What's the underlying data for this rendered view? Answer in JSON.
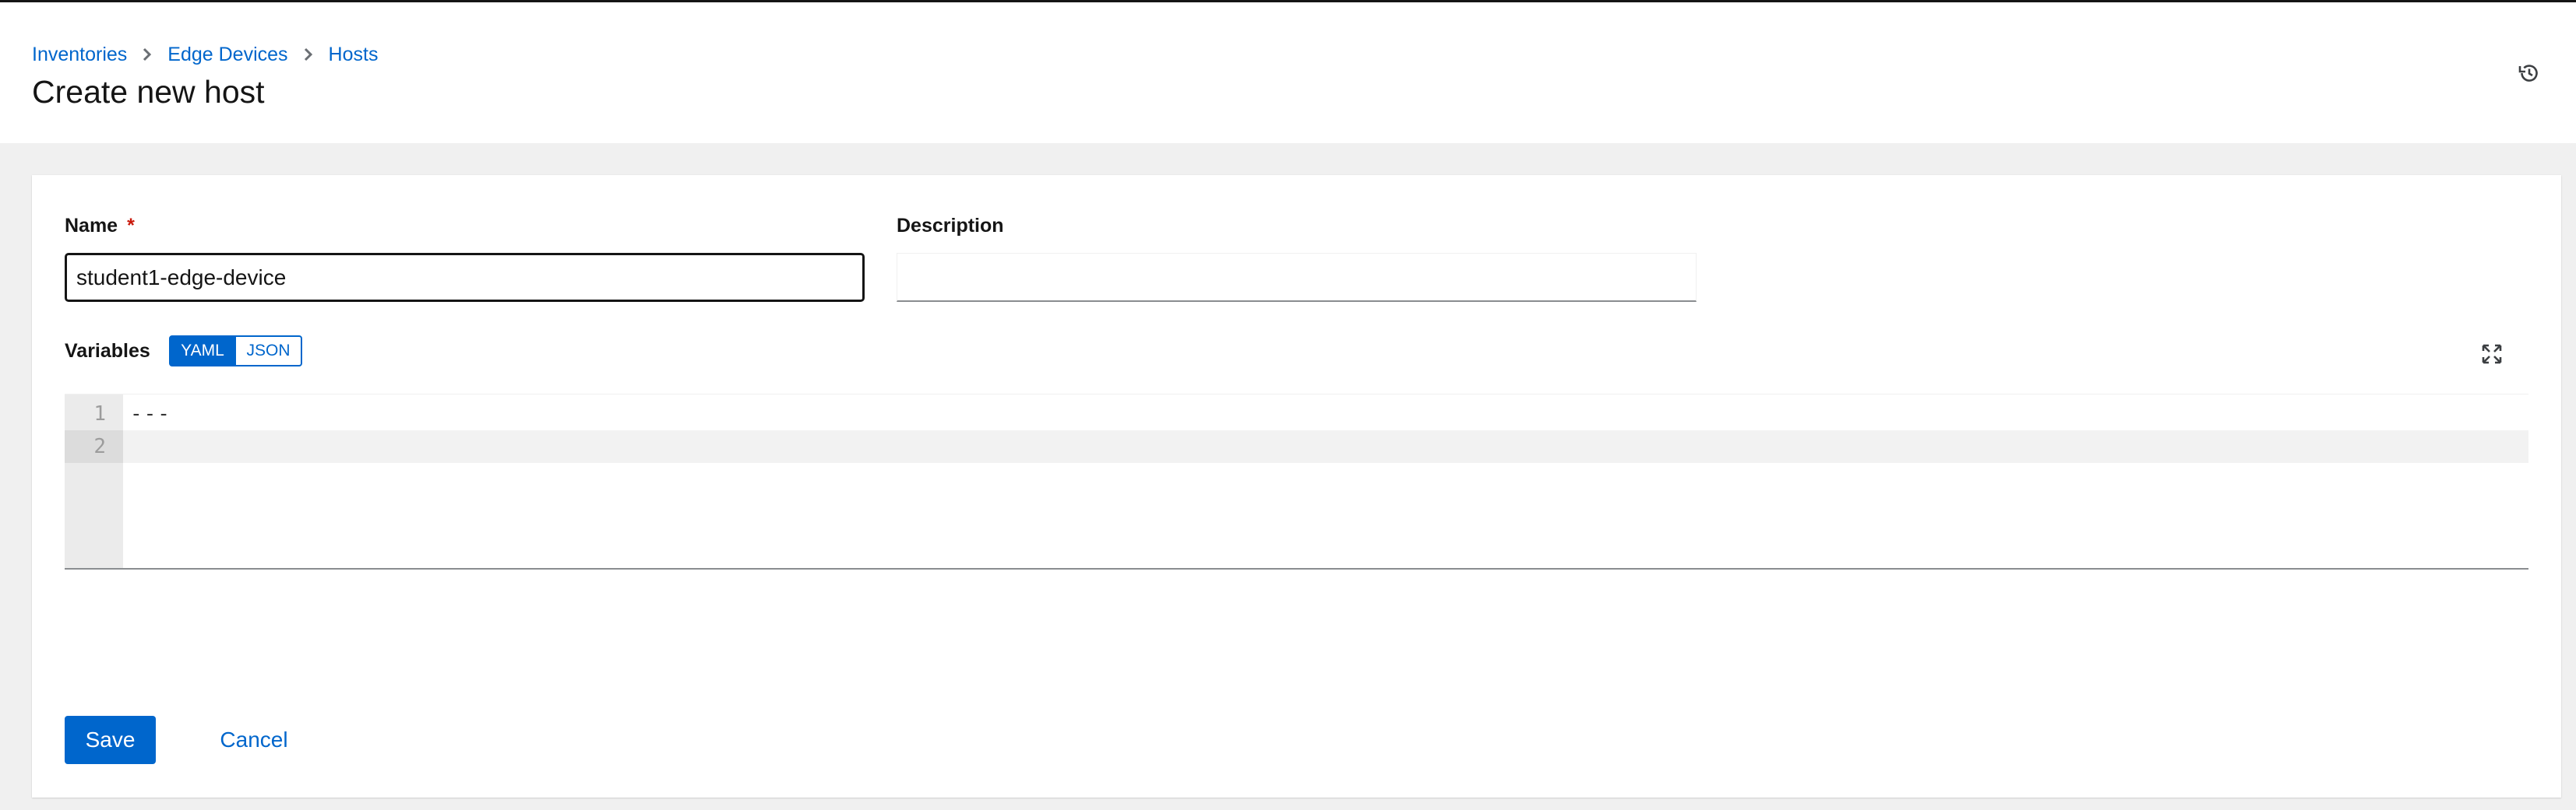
{
  "breadcrumb": {
    "items": [
      {
        "label": "Inventories"
      },
      {
        "label": "Edge Devices"
      },
      {
        "label": "Hosts"
      }
    ]
  },
  "header": {
    "title": "Create new host",
    "history_icon": "history-icon"
  },
  "form": {
    "name": {
      "label": "Name",
      "required_marker": "*",
      "value": "student1-edge-device"
    },
    "description": {
      "label": "Description",
      "value": ""
    },
    "variables": {
      "label": "Variables",
      "toggle": {
        "yaml_label": "YAML",
        "json_label": "JSON",
        "selected": "YAML"
      },
      "expand_icon": "expand-icon",
      "editor": {
        "lines": [
          {
            "number": "1",
            "text": "---"
          },
          {
            "number": "2",
            "text": ""
          }
        ]
      }
    }
  },
  "actions": {
    "save_label": "Save",
    "cancel_label": "Cancel"
  },
  "colors": {
    "accent": "#0066cc",
    "required": "#c9190b",
    "page_background": "#f0f0f0"
  }
}
